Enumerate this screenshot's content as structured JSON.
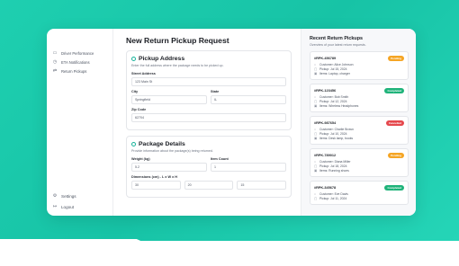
{
  "sidebar": {
    "items": [
      {
        "icon": "chart-icon",
        "glyph": "▭",
        "label": "Driver Performance"
      },
      {
        "icon": "clock-icon",
        "glyph": "◷",
        "label": "ETA Notifications"
      },
      {
        "icon": "return-icon",
        "glyph": "⇄",
        "label": "Return Pickups"
      }
    ],
    "bottom": [
      {
        "icon": "gear-icon",
        "glyph": "⚙",
        "label": "Settings"
      },
      {
        "icon": "logout-icon",
        "glyph": "↦",
        "label": "Logout"
      }
    ]
  },
  "page": {
    "title": "New Return Pickup Request"
  },
  "pickup": {
    "title": "Pickup Address",
    "description": "Enter the full address where the package needs to be picked up.",
    "street_label": "Street Address",
    "street_value": "123 Main St",
    "city_label": "City",
    "city_value": "Springfield",
    "state_label": "State",
    "state_value": "IL",
    "zip_label": "Zip Code",
    "zip_value": "62704"
  },
  "package": {
    "title": "Package Details",
    "description": "Provide information about the package(s) being returned.",
    "weight_label": "Weight (kg)",
    "weight_value": "5.2",
    "count_label": "Item Count",
    "count_value": "1",
    "dims_label": "Dimensions (cm) - L x W x H",
    "length_value": "30",
    "width_value": "20",
    "height_value": "15"
  },
  "recent": {
    "title": "Recent Return Pickups",
    "subtitle": "Overview of your latest return requests.",
    "items": [
      {
        "id": "#RPK-456789",
        "status": "Pending",
        "color": "#f5a524",
        "customer": "Customer: Alice Johnson",
        "pickup": "Pickup: Jul 15, 2024",
        "items": "Items: Laptop, charger"
      },
      {
        "id": "#RPK-123456",
        "status": "Completed",
        "color": "#1fb37a",
        "customer": "Customer: Bob Smith",
        "pickup": "Pickup: Jul 12, 2024",
        "items": "Items: Wireless Headphones"
      },
      {
        "id": "#RPK-987654",
        "status": "Cancelled",
        "color": "#e5484d",
        "customer": "Customer: Charlie Brown",
        "pickup": "Pickup: Jul 10, 2024",
        "items": "Items: Desk lamp, books"
      },
      {
        "id": "#RPK-789012",
        "status": "Pending",
        "color": "#f5a524",
        "customer": "Customer: Diana Miller",
        "pickup": "Pickup: Jul 18, 2024",
        "items": "Items: Running shoes"
      },
      {
        "id": "#RPK-345678",
        "status": "Completed",
        "color": "#1fb37a",
        "customer": "Customer: Eve Davis",
        "pickup": "Pickup: Jul 11, 2024",
        "items": ""
      }
    ]
  }
}
